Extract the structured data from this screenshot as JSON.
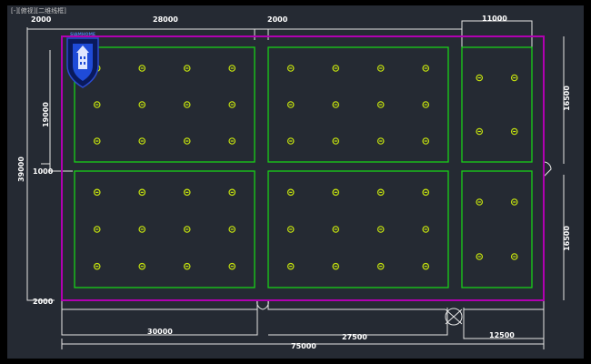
{
  "viewport": {
    "title": "[-][俯视][二维线框]"
  },
  "dimensions": {
    "top_left_2000": "2000",
    "top_28000": "28000",
    "top_mid_2000": "2000",
    "top_11000": "11000",
    "left_19000": "19000",
    "left_39000": "39000",
    "left_1000": "1000",
    "left_bottom_2000": "2000",
    "right_top_16500": "16500",
    "right_bottom_16500": "16500",
    "bottom_30000": "30000",
    "bottom_27500": "27500",
    "bottom_12500": "12500",
    "bottom_75000": "75000"
  },
  "logo": {
    "text": "SIAMHOME"
  },
  "colors": {
    "background": "#252a33",
    "outline": "#b100b1",
    "zones": "#18d018",
    "fixtures": "#c8e60e",
    "dimensions": "#e6e6e6"
  },
  "zones": [
    {
      "name": "top-left",
      "rows": 3,
      "cols": 4
    },
    {
      "name": "top-middle",
      "rows": 3,
      "cols": 4
    },
    {
      "name": "top-right",
      "rows": 2,
      "cols": 2
    },
    {
      "name": "bottom-left",
      "rows": 3,
      "cols": 4
    },
    {
      "name": "bottom-middle",
      "rows": 3,
      "cols": 4
    },
    {
      "name": "bottom-right",
      "rows": 2,
      "cols": 2
    }
  ]
}
